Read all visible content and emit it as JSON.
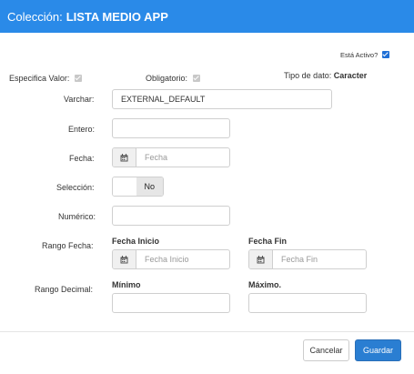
{
  "header": {
    "title_prefix": "Colección:",
    "title_name": "LISTA MEDIO APP",
    "bg_color": "#2a8ae8"
  },
  "flags": {
    "activo_label": "Está Activo?",
    "activo_checked": true,
    "especifica_label": "Especifica Valor:",
    "especifica_checked": true,
    "obligatorio_label": "Obligatorio:",
    "obligatorio_checked": true,
    "tipo_label": "Tipo de dato:",
    "tipo_value": "Caracter"
  },
  "fields": {
    "varchar_label": "Varchar:",
    "varchar_value": "EXTERNAL_DEFAULT",
    "entero_label": "Entero:",
    "entero_value": "",
    "fecha_label": "Fecha:",
    "fecha_placeholder": "Fecha",
    "seleccion_label": "Selección:",
    "seleccion_value": "No",
    "numerico_label": "Numérico:",
    "numerico_value": "",
    "rango_fecha_label": "Rango Fecha:",
    "fecha_inicio_header": "Fecha Inicio",
    "fecha_inicio_placeholder": "Fecha Inicio",
    "fecha_fin_header": "Fecha Fin",
    "fecha_fin_placeholder": "Fecha Fin",
    "rango_decimal_label": "Rango Decimal:",
    "minimo_header": "Mínimo",
    "minimo_value": "",
    "maximo_header": "Máximo.",
    "maximo_value": ""
  },
  "footer": {
    "cancel_label": "Cancelar",
    "save_label": "Guardar"
  },
  "icons": {
    "calendar": "calendar-icon"
  }
}
